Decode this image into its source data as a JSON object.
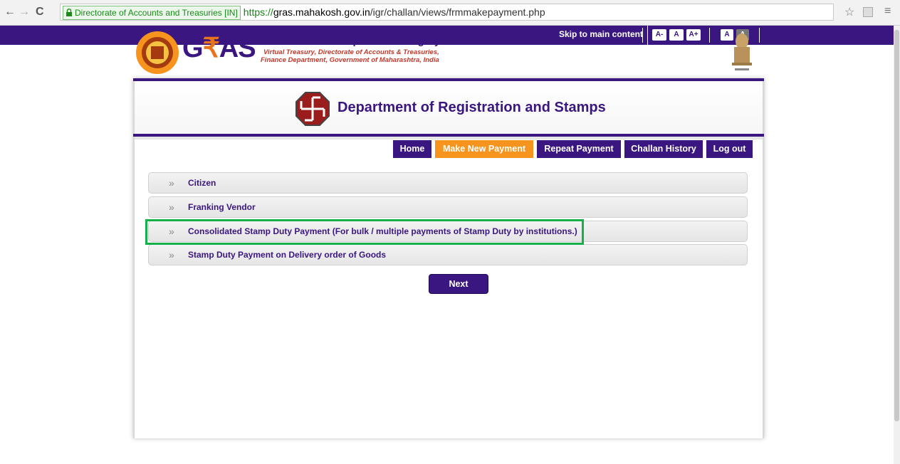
{
  "browser": {
    "back": "←",
    "forward": "→",
    "reload": "C",
    "cert_label": "Directorate of Accounts and Treasuries [IN]",
    "url_scheme": "https://",
    "url_domain": "gras.mahakosh.gov.in",
    "url_path": "/igr/challan/views/frmmakepayment.php",
    "star": "☆",
    "menu": "≡"
  },
  "topbar": {
    "skip": "Skip to main content",
    "font_smaller": "A-",
    "font_normal": "A",
    "font_larger": "A+",
    "contrast_light": "A",
    "contrast_dark": "A"
  },
  "logo": {
    "g": "G",
    "rupee": "₹",
    "as": "AS",
    "title": "Government Receipt Accounting System",
    "sub1": "Virtual Treasury, Directorate of Accounts & Treasuries,",
    "sub2": "Finance Department, Government of Maharashtra, India"
  },
  "department": {
    "title": "Department of Registration and Stamps"
  },
  "menu": {
    "home": "Home",
    "make_new_payment": "Make New Payment",
    "repeat_payment": "Repeat Payment",
    "challan_history": "Challan History",
    "log_out": "Log out"
  },
  "options": [
    {
      "label": "Citizen"
    },
    {
      "label": "Franking Vendor"
    },
    {
      "label": "Consolidated Stamp Duty Payment (For bulk / multiple payments of Stamp Duty by institutions.)"
    },
    {
      "label": "Stamp Duty Payment on Delivery order of Goods"
    }
  ],
  "next_label": "Next",
  "colors": {
    "brand_purple": "#3a1680",
    "active_orange": "#f7941d",
    "highlight_green": "#16b04a"
  }
}
